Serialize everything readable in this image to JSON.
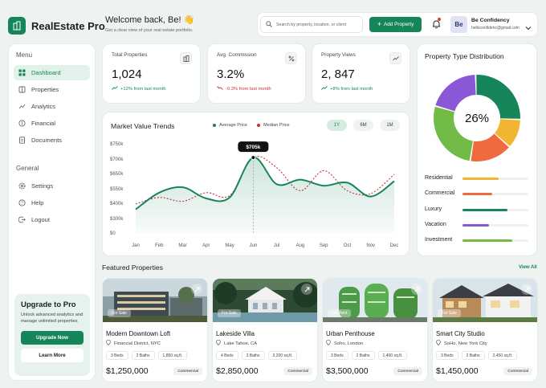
{
  "app": {
    "title": "RealEstate Pro"
  },
  "header": {
    "welcome": "Welcome back, Be! 👋",
    "subtitle": "Get a clear view of your real estate portfolio.",
    "search_placeholder": "Search by property, location, or client",
    "add_button": "Add Property",
    "user": {
      "initials": "Be",
      "name": "Be Confidency",
      "email": "helloconfidenc@gmail.com"
    }
  },
  "sidebar": {
    "menu_label": "Menu",
    "menu": [
      {
        "label": "Dashboard",
        "icon": "dashboard-icon"
      },
      {
        "label": "Properties",
        "icon": "building-icon"
      },
      {
        "label": "Analytics",
        "icon": "analytics-icon"
      },
      {
        "label": "Financial",
        "icon": "dollar-icon"
      },
      {
        "label": "Documents",
        "icon": "document-icon"
      }
    ],
    "general_label": "General",
    "general": [
      {
        "label": "Settings",
        "icon": "gear-icon"
      },
      {
        "label": "Help",
        "icon": "help-icon"
      },
      {
        "label": "Logout",
        "icon": "logout-icon"
      }
    ],
    "promo": {
      "title": "Upgrade to Pro",
      "text": "Unlock advanced analytics and manage unlimited properties",
      "primary": "Upgrade Now",
      "secondary": "Learn More"
    }
  },
  "stats": [
    {
      "label": "Total Properties",
      "value": "1,024",
      "change": "+12% from last month",
      "direction": "up",
      "icon": "building-icon"
    },
    {
      "label": "Avg. Commission",
      "value": "3.2%",
      "change": "-0.3% from last month",
      "direction": "down",
      "icon": "percent-icon"
    },
    {
      "label": "Property Views",
      "value": "2, 847",
      "change": "+8% from last month",
      "direction": "up",
      "icon": "trend-icon"
    }
  ],
  "market": {
    "title": "Market Value Trends",
    "legend": [
      "Average Price",
      "Median Price"
    ],
    "ranges": [
      "1Y",
      "6M",
      "1M"
    ],
    "active_range": "1Y",
    "tooltip": "$705k"
  },
  "chart_data": {
    "type": "line",
    "categories": [
      "Jan",
      "Feb",
      "Mar",
      "Apr",
      "May",
      "Jun",
      "Jul",
      "Aug",
      "Sep",
      "Oct",
      "Nov",
      "Dec"
    ],
    "y_ticks": [
      "$0",
      "$300k",
      "$400k",
      "$550k",
      "$650k",
      "$700k",
      "$750k"
    ],
    "series": [
      {
        "name": "Average Price",
        "color": "#17855a",
        "values": [
          360,
          510,
          560,
          450,
          460,
          705,
          580,
          610,
          570,
          590,
          470,
          600
        ]
      },
      {
        "name": "Median Price",
        "color": "#c8303c",
        "values": [
          395,
          460,
          420,
          510,
          480,
          705,
          670,
          530,
          660,
          530,
          500,
          645
        ]
      }
    ],
    "highlight": {
      "category": "Jun",
      "value": 705
    }
  },
  "distribution": {
    "title": "Property Type Distribution",
    "center": "26%",
    "slices": [
      {
        "name": "Green",
        "color": "#17855a",
        "value": 26
      },
      {
        "name": "Yellow",
        "color": "#f2b532",
        "value": 11
      },
      {
        "name": "Orange",
        "color": "#ef6a3f",
        "value": 16
      },
      {
        "name": "Lime",
        "color": "#72bb46",
        "value": 27
      },
      {
        "name": "Purple",
        "color": "#8a58d6",
        "value": 20
      }
    ],
    "bars": [
      {
        "label": "Residential",
        "color": "#f2b532",
        "fraction": 0.55
      },
      {
        "label": "Commercial",
        "color": "#ef6a3f",
        "fraction": 0.45
      },
      {
        "label": "Luxury",
        "color": "#17855a",
        "fraction": 0.68
      },
      {
        "label": "Vacation",
        "color": "#8a58d6",
        "fraction": 0.4
      },
      {
        "label": "Investment",
        "color": "#72bb46",
        "fraction": 0.75
      }
    ]
  },
  "featured": {
    "title": "Featured Properties",
    "view_all": "View All",
    "items": [
      {
        "name": "Modern Downtown Loft",
        "location": "Financial District, NYC",
        "tag": "For Sale",
        "chips": [
          "3 Beds",
          "2 Baths",
          "1,850 sq.ft."
        ],
        "price": "$1,250,000",
        "type": "Commercial"
      },
      {
        "name": "Lakeside Villa",
        "location": "Lake Tahoe, CA",
        "tag": "For Sale",
        "chips": [
          "4 Beds",
          "3 Baths",
          "3,200 sq.ft."
        ],
        "price": "$2,850,000",
        "type": "Commercial"
      },
      {
        "name": "Urban Penthouse",
        "location": "Soho, London",
        "tag": "For Rent",
        "chips": [
          "3 Beds",
          "2 Baths",
          "1,400 sq.ft."
        ],
        "price": "$3,500,000",
        "type": "Commercial"
      },
      {
        "name": "Smart City Studio",
        "location": "SoHo, New York City",
        "tag": "For Sale",
        "chips": [
          "3 Beds",
          "2 Baths",
          "2,450 sq.ft."
        ],
        "price": "$1,450,000",
        "type": "Commercial"
      }
    ]
  }
}
